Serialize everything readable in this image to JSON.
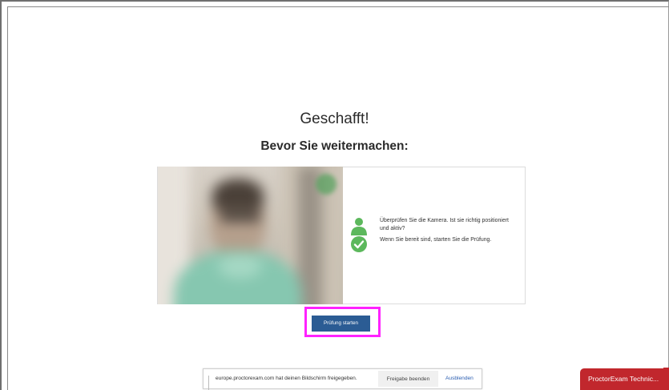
{
  "heading": {
    "title": "Geschafft!",
    "subtitle": "Bevor Sie weitermachen:"
  },
  "instructions": {
    "line1": "Überprüfen Sie die Kamera. Ist sie richtig positioniert und aktiv?",
    "line2": "Wenn Sie bereit sind, starten Sie die Prüfung."
  },
  "icons": {
    "person": "person-icon",
    "check": "check-circle-icon",
    "recording": "camera-active-indicator"
  },
  "actions": {
    "start_label": "Prüfung starten"
  },
  "share_bar": {
    "message": "europe.proctorexam.com hat deinen Bildschirm freigegeben.",
    "stop_label": "Freigabe beenden",
    "hide_label": "Ausblenden"
  },
  "support_tab": {
    "label": "ProctorExam Technic..."
  },
  "colors": {
    "primary_button": "#2b5c94",
    "highlight": "#ff22ff",
    "success": "#5cb85c",
    "support_tab": "#c1272d",
    "link": "#2a5db0"
  }
}
